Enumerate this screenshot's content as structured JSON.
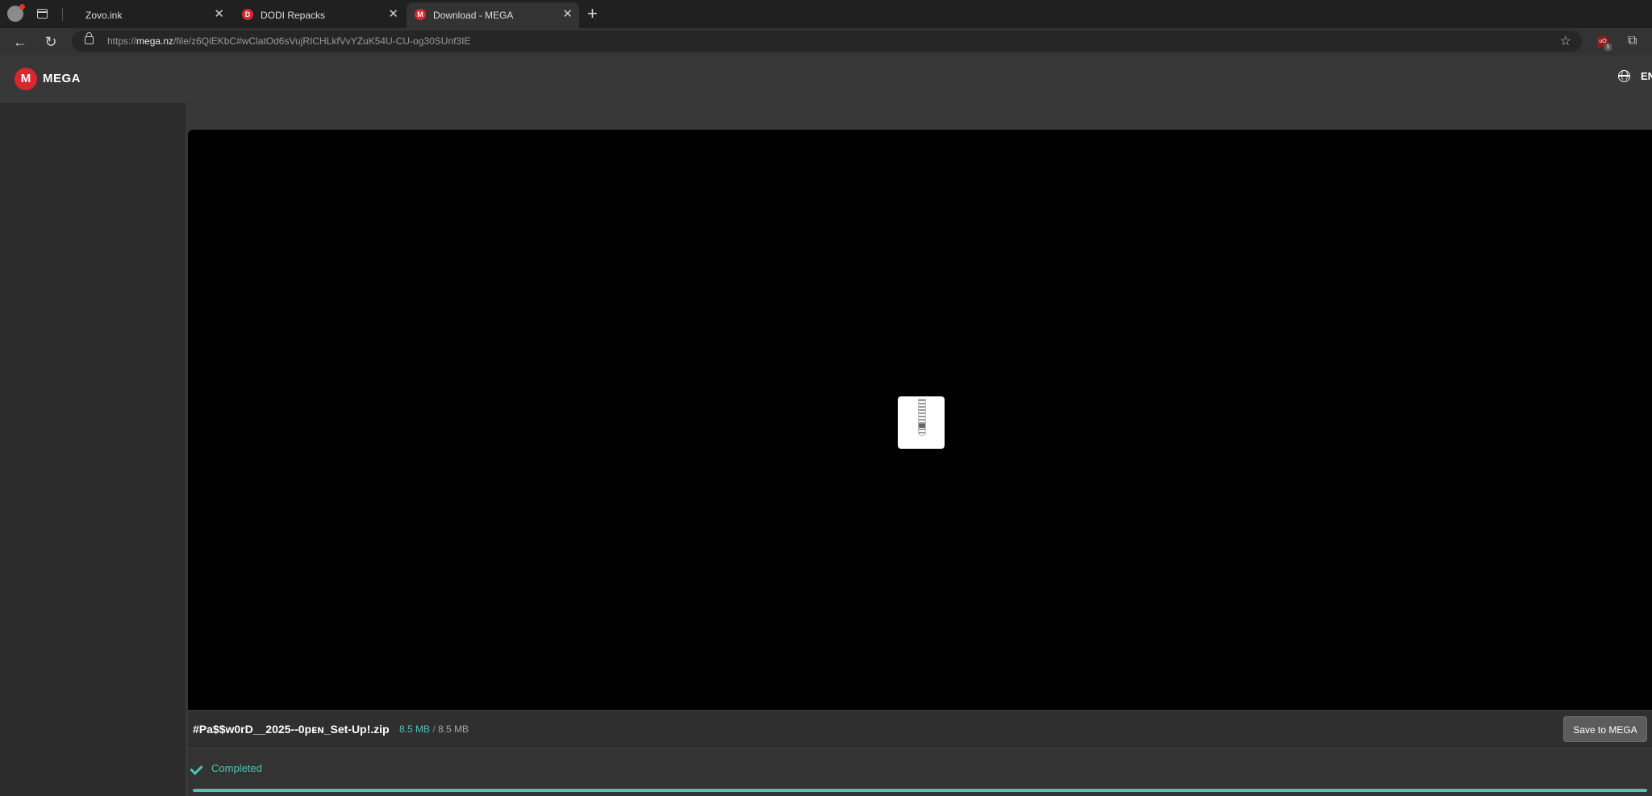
{
  "browser": {
    "tabs": [
      {
        "title": "Zovo.ink",
        "favicon": ""
      },
      {
        "title": "DODI Repacks",
        "favicon": "D"
      },
      {
        "title": "Download - MEGA",
        "favicon": "M",
        "active": true
      }
    ],
    "url": {
      "scheme": "https://",
      "host": "mega.nz",
      "path": "/file/z6QiEKbC#wClatOd6sVujRICHLkfVvYZuK54U-CU-og30SUnf3IE"
    },
    "extension_badge": "1"
  },
  "header": {
    "logo_letter": "M",
    "logo_text": "MEGA",
    "language": "EN"
  },
  "file": {
    "name": "#Pa$$w0rD__2025--0pᴇɴ_Set-Up!.zip",
    "downloaded": "8.5 MB",
    "separator": "/",
    "total": "8.5 MB",
    "icon": "zip-file-icon"
  },
  "actions": {
    "save_label": "Save to MEGA"
  },
  "status": {
    "label": "Completed",
    "progress": 1.0
  },
  "colors": {
    "accent": "#4fc4b6",
    "brand": "#d9272e"
  }
}
